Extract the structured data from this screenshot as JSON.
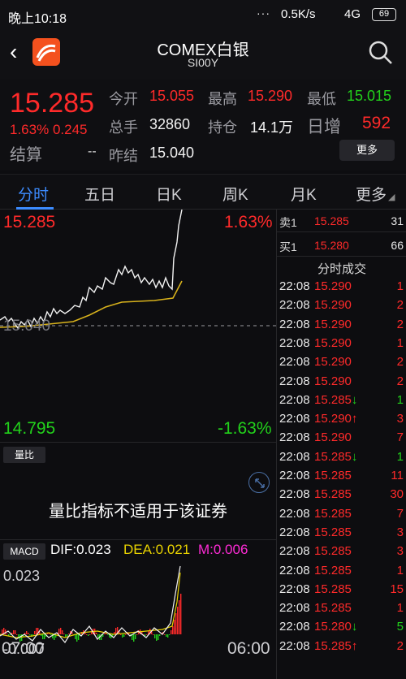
{
  "status": {
    "time": "晚上10:18",
    "dots": "···",
    "net": "0.5K/s",
    "signal": "4G",
    "battery": "69"
  },
  "header": {
    "title": "COMEX白银",
    "subtitle": "SI00Y"
  },
  "quote": {
    "price": "15.285",
    "change_pct": "1.63%",
    "change_abs": "0.245",
    "settle_label": "结算",
    "settle_value": "--",
    "fields": [
      {
        "label": "今开",
        "value": "15.055",
        "color": "red"
      },
      {
        "label": "最高",
        "value": "15.290",
        "color": "red"
      },
      {
        "label": "最低",
        "value": "15.015",
        "color": "green"
      },
      {
        "label": "总手",
        "value": "32860",
        "color": "white"
      },
      {
        "label": "持仓",
        "value": "14.1万",
        "color": "white"
      },
      {
        "label": "日增",
        "value": "592",
        "color": "red"
      },
      {
        "label": "昨结",
        "value": "15.040",
        "color": "white"
      }
    ],
    "more_label": "更多"
  },
  "tabs": [
    {
      "label": "分时",
      "active": true
    },
    {
      "label": "五日",
      "active": false
    },
    {
      "label": "日K",
      "active": false
    },
    {
      "label": "周K",
      "active": false
    },
    {
      "label": "月K",
      "active": false
    },
    {
      "label": "更多",
      "active": false
    }
  ],
  "chart_labels": {
    "price_high": "15.285",
    "pct_high": "1.63%",
    "price_low": "14.795",
    "pct_low": "-1.63%",
    "prev_close": "15.040",
    "time_start": "07:00",
    "time_end": "06:00"
  },
  "volume": {
    "tag": "量比",
    "message": "量比指标不适用于该证券"
  },
  "macd": {
    "tag": "MACD",
    "dif": "DIF:0.023",
    "dea": "DEA:0.021",
    "m": "M:0.006",
    "y_top": "0.023",
    "y_bottom": "-0.007"
  },
  "orderbook": [
    {
      "label": "卖1",
      "price": "15.285",
      "qty": "31"
    },
    {
      "label": "买1",
      "price": "15.280",
      "qty": "66"
    }
  ],
  "trades_title": "分时成交",
  "trades": [
    {
      "time": "22:08",
      "price": "15.290",
      "arrow": "",
      "vol": "1"
    },
    {
      "time": "22:08",
      "price": "15.290",
      "arrow": "",
      "vol": "2"
    },
    {
      "time": "22:08",
      "price": "15.290",
      "arrow": "",
      "vol": "2"
    },
    {
      "time": "22:08",
      "price": "15.290",
      "arrow": "",
      "vol": "1"
    },
    {
      "time": "22:08",
      "price": "15.290",
      "arrow": "",
      "vol": "2"
    },
    {
      "time": "22:08",
      "price": "15.290",
      "arrow": "",
      "vol": "2"
    },
    {
      "time": "22:08",
      "price": "15.285",
      "arrow": "↓",
      "vol": "1"
    },
    {
      "time": "22:08",
      "price": "15.290",
      "arrow": "↑",
      "vol": "3"
    },
    {
      "time": "22:08",
      "price": "15.290",
      "arrow": "",
      "vol": "7"
    },
    {
      "time": "22:08",
      "price": "15.285",
      "arrow": "↓",
      "vol": "1"
    },
    {
      "time": "22:08",
      "price": "15.285",
      "arrow": "",
      "vol": "11"
    },
    {
      "time": "22:08",
      "price": "15.285",
      "arrow": "",
      "vol": "30"
    },
    {
      "time": "22:08",
      "price": "15.285",
      "arrow": "",
      "vol": "7"
    },
    {
      "time": "22:08",
      "price": "15.285",
      "arrow": "",
      "vol": "3"
    },
    {
      "time": "22:08",
      "price": "15.285",
      "arrow": "",
      "vol": "3"
    },
    {
      "time": "22:08",
      "price": "15.285",
      "arrow": "",
      "vol": "1"
    },
    {
      "time": "22:08",
      "price": "15.285",
      "arrow": "",
      "vol": "15"
    },
    {
      "time": "22:08",
      "price": "15.285",
      "arrow": "",
      "vol": "1"
    },
    {
      "time": "22:08",
      "price": "15.280",
      "arrow": "↓",
      "vol": "5"
    },
    {
      "time": "22:08",
      "price": "15.285",
      "arrow": "↑",
      "vol": "2"
    }
  ],
  "colors": {
    "up": "#ff2a2a",
    "down": "#22d11b",
    "accent": "#3c8cff",
    "avg_line": "#d8b21c",
    "dea": "#e8d200",
    "m": "#ff2bd6"
  }
}
